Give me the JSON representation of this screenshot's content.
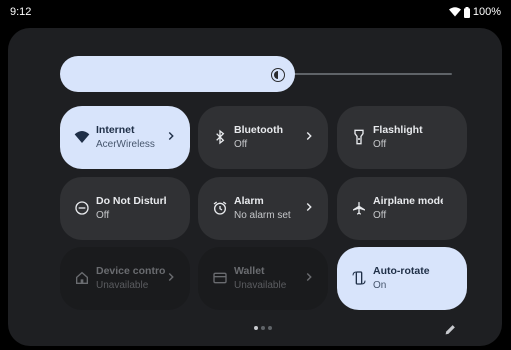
{
  "status_bar": {
    "time": "9:12",
    "battery": "100%"
  },
  "brightness": {
    "level": 0.6
  },
  "tiles": [
    {
      "label": "Internet",
      "sub": "AcerWireless",
      "icon": "wifi-icon",
      "state": "active",
      "chevron": true
    },
    {
      "label": "Bluetooth",
      "sub": "Off",
      "icon": "bluetooth-icon",
      "state": "off",
      "chevron": true
    },
    {
      "label": "Flashlight",
      "sub": "Off",
      "icon": "flashlight-icon",
      "state": "off",
      "chevron": false
    },
    {
      "label": "Do Not Disturb",
      "sub": "Off",
      "icon": "do-not-disturb-icon",
      "state": "off",
      "chevron": false
    },
    {
      "label": "Alarm",
      "sub": "No alarm set",
      "icon": "alarm-icon",
      "state": "off",
      "chevron": true
    },
    {
      "label": "Airplane mode",
      "sub": "Off",
      "icon": "airplane-icon",
      "state": "off",
      "chevron": false
    },
    {
      "label": "Device controls",
      "sub": "Unavailable",
      "icon": "home-icon",
      "state": "disabled",
      "chevron": true
    },
    {
      "label": "Wallet",
      "sub": "Unavailable",
      "icon": "wallet-icon",
      "state": "disabled",
      "chevron": true
    },
    {
      "label": "Auto-rotate",
      "sub": "On",
      "icon": "auto-rotate-icon",
      "state": "active",
      "chevron": false
    }
  ],
  "pager": {
    "pages": 3,
    "current": 1
  },
  "colors": {
    "active_tile": "#d8e4fb",
    "inactive_tile": "#303134",
    "panel": "#1e1f22"
  }
}
